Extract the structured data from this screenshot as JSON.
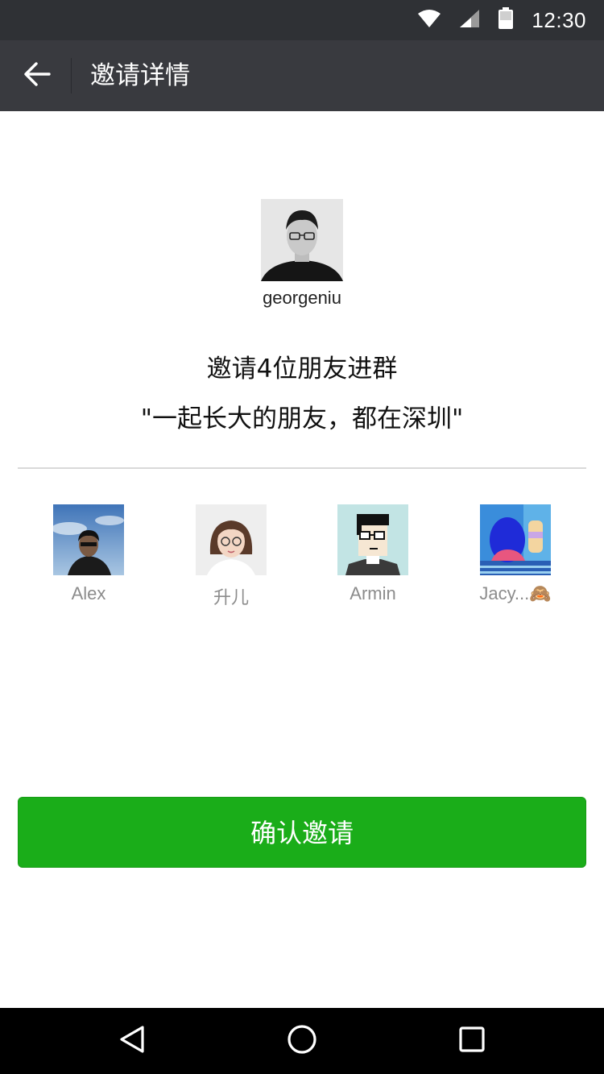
{
  "status_bar": {
    "time": "12:30",
    "icons": [
      "wifi-icon",
      "signal-icon",
      "battery-icon"
    ]
  },
  "navbar": {
    "title": "邀请详情",
    "back_icon": "back-arrow-icon"
  },
  "inviter": {
    "name": "georgeniu"
  },
  "invite": {
    "title": "邀请4位朋友进群",
    "group_name": "\"一起长大的朋友，都在深圳\""
  },
  "friends": [
    {
      "name": "Alex"
    },
    {
      "name": "升儿"
    },
    {
      "name": "Armin"
    },
    {
      "name": "Jacy...🙈"
    }
  ],
  "confirm_button": {
    "label": "确认邀请"
  },
  "colors": {
    "accent": "#1aad19",
    "navbar": "#393a3f",
    "statusbar": "#2f3135"
  },
  "system_nav": [
    "back-triangle-icon",
    "home-circle-icon",
    "recents-square-icon"
  ]
}
